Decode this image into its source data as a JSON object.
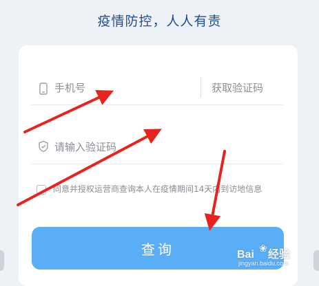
{
  "header": {
    "slogan": "疫情防控，人人有责"
  },
  "form": {
    "phone": {
      "placeholder": "手机号",
      "icon": "phone-icon"
    },
    "get_code_label": "获取验证码",
    "code": {
      "placeholder": "请输入验证码",
      "icon": "shield-icon"
    },
    "consent_text": "同意并授权运营商查询本人在疫情期间14天内到访地信息",
    "consent_checked": false,
    "submit_label": "查询"
  },
  "watermark": {
    "brand_left": "Bai",
    "brand_right": "经验",
    "paw": "paw-icon",
    "url": "jingyan.baidu.com"
  },
  "colors": {
    "accent": "#5aaef6",
    "slogan": "#1e4f8f",
    "arrow": "#e8221c",
    "muted_text": "#8a8e96"
  }
}
